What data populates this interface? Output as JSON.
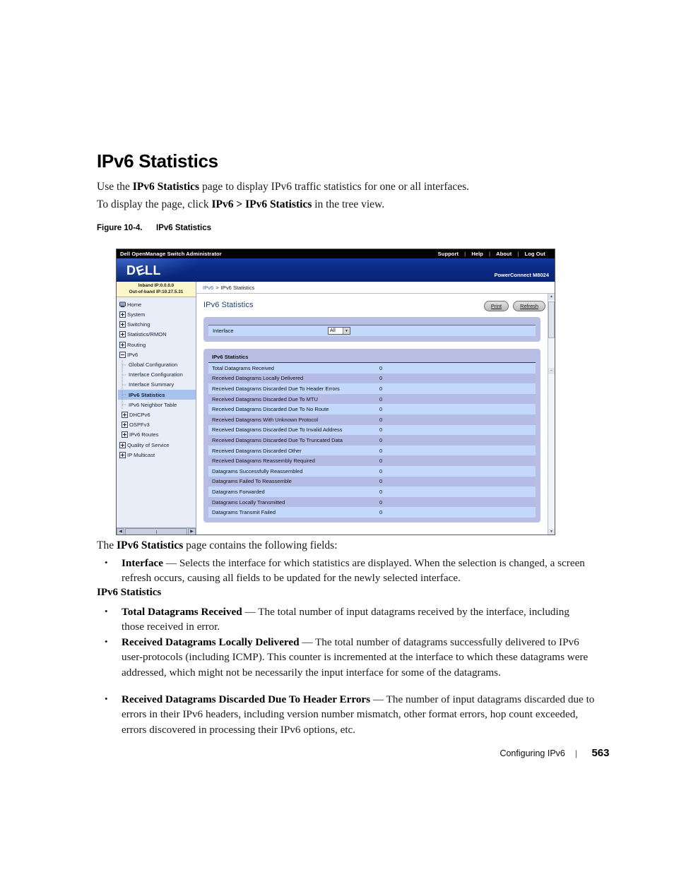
{
  "document": {
    "title": "IPv6 Statistics",
    "intro_line_1_pre": "Use the ",
    "intro_line_1_bold": "IPv6 Statistics",
    "intro_line_1_post": " page to display IPv6 traffic statistics for one or all interfaces.",
    "intro_line_2_pre": "To display the page, click ",
    "intro_line_2_bold": "IPv6 > IPv6 Statistics",
    "intro_line_2_post": " in the tree view.",
    "figure_number": "Figure 10-4.",
    "figure_title": "IPv6 Statistics",
    "lead_pre": "The ",
    "lead_bold": "IPv6 Statistics",
    "lead_post": " page contains the following fields:",
    "subhead": "IPv6 Statistics",
    "bullets": [
      {
        "term": "Interface",
        "dash": " — ",
        "text": "Selects the interface for which statistics are displayed. When the selection is changed, a screen refresh occurs, causing all fields to be updated for the newly selected interface."
      },
      {
        "term": "Total Datagrams Received",
        "dash": " — ",
        "text": "The total number of input datagrams received by the interface, including those received in error."
      },
      {
        "term": "Received Datagrams Locally Delivered",
        "dash": " — ",
        "text": "The total number of datagrams successfully delivered to IPv6 user-protocols (including ICMP). This counter is incremented at the interface to which these datagrams were addressed, which might not be necessarily the input interface for some of the datagrams."
      },
      {
        "term": "Received Datagrams Discarded Due To Header Errors",
        "dash": " — ",
        "text": "The number of input datagrams discarded due to errors in their IPv6 headers, including version number mismatch, other format errors, hop count exceeded, errors discovered in processing their IPv6 options, etc."
      }
    ],
    "footer": {
      "chapter": "Configuring IPv6",
      "separator": "|",
      "page_number": "563"
    }
  },
  "screenshot": {
    "titlebar": {
      "app_title": "Dell OpenManage Switch Administrator",
      "links": [
        "Support",
        "Help",
        "About",
        "Log Out"
      ]
    },
    "banner": {
      "logo_text_1": "D",
      "logo_text_2": "E",
      "logo_text_3": "LL",
      "model": "PowerConnect M8024"
    },
    "sidebar": {
      "inband_ip": "Inband IP:0.0.0.0",
      "oob_ip": "Out-of-band IP:10.27.5.31",
      "tree": [
        {
          "label": "Home",
          "icon": "monitor-icon",
          "level": 1,
          "state": "none",
          "selected": false
        },
        {
          "label": "System",
          "icon": "expand-plus-icon",
          "level": 1,
          "state": "collapsed",
          "selected": false
        },
        {
          "label": "Switching",
          "icon": "expand-plus-icon",
          "level": 1,
          "state": "collapsed",
          "selected": false
        },
        {
          "label": "Statistics/RMON",
          "icon": "expand-plus-icon",
          "level": 1,
          "state": "collapsed",
          "selected": false
        },
        {
          "label": "Routing",
          "icon": "expand-plus-icon",
          "level": 1,
          "state": "collapsed",
          "selected": false
        },
        {
          "label": "IPv6",
          "icon": "collapse-minus-icon",
          "level": 1,
          "state": "expanded",
          "selected": false
        },
        {
          "label": "Global Configuration",
          "icon": "tree-branch-icon",
          "level": 2,
          "state": "leaf",
          "selected": false
        },
        {
          "label": "Interface Configuration",
          "icon": "tree-branch-icon",
          "level": 2,
          "state": "leaf",
          "selected": false
        },
        {
          "label": "Interface Summary",
          "icon": "tree-branch-icon",
          "level": 2,
          "state": "leaf",
          "selected": false
        },
        {
          "label": "IPv6 Statistics",
          "icon": "tree-branch-icon",
          "level": 2,
          "state": "leaf",
          "selected": true
        },
        {
          "label": "IPv6 Neighbor Table",
          "icon": "tree-branch-icon",
          "level": 2,
          "state": "leaf",
          "selected": false
        },
        {
          "label": "DHCPv6",
          "icon": "expand-plus-icon",
          "level": 2,
          "state": "collapsed",
          "selected": false
        },
        {
          "label": "OSPFv3",
          "icon": "expand-plus-icon",
          "level": 2,
          "state": "collapsed",
          "selected": false
        },
        {
          "label": "IPv6 Routes",
          "icon": "expand-plus-icon",
          "level": 2,
          "state": "collapsed",
          "selected": false
        },
        {
          "label": "Quality of Service",
          "icon": "expand-plus-icon",
          "level": 1,
          "state": "collapsed",
          "selected": false
        },
        {
          "label": "IP Multicast",
          "icon": "expand-plus-icon",
          "level": 1,
          "state": "collapsed",
          "selected": false
        }
      ]
    },
    "breadcrumb": {
      "parent": "IPv6",
      "separator": ">",
      "current": "IPv6 Statistics"
    },
    "panel": {
      "title": "IPv6 Statistics",
      "print_button": "Print",
      "refresh_button": "Refresh",
      "interface_label": "Interface",
      "interface_value": "All",
      "stats_header": "IPv6 Statistics",
      "rows": [
        {
          "label": "Total Datagrams Received",
          "value": "0"
        },
        {
          "label": "Received Datagrams Locally Delivered",
          "value": "0"
        },
        {
          "label": "Received Datagrams Discarded Due To Header Errors",
          "value": "0"
        },
        {
          "label": "Received Datagrams Discarded Due To MTU",
          "value": "0"
        },
        {
          "label": "Received Datagrams Discarded Due To No Route",
          "value": "0"
        },
        {
          "label": "Received Datagrams With Unknown Protocol",
          "value": "0"
        },
        {
          "label": "Received Datagrams Discarded Due To Invalid Address",
          "value": "0"
        },
        {
          "label": "Received Datagrams Discarded Due To Truncated Data",
          "value": "0"
        },
        {
          "label": "Received Datagrams Discarded Other",
          "value": "0"
        },
        {
          "label": "Received Datagrams Reassembly Required",
          "value": "0"
        },
        {
          "label": "Datagrams Successfully Reassembled",
          "value": "0"
        },
        {
          "label": "Datagrams Failed To Reassemble",
          "value": "0"
        },
        {
          "label": "Datagrams Forwarded",
          "value": "0"
        },
        {
          "label": "Datagrams Locally Transmitted",
          "value": "0"
        },
        {
          "label": "Datagrams Transmit Failed",
          "value": "0"
        }
      ]
    },
    "colors": {
      "banner_blue": "#0a2a85",
      "panel_blue": "#b9bee4",
      "row_odd": "#c3d8fb",
      "row_even": "#b4bbe4",
      "selected_node": "#a8c4ee",
      "ipinfo_yellow": "#fbf6cc",
      "link_blue": "#3b5fa8"
    }
  }
}
